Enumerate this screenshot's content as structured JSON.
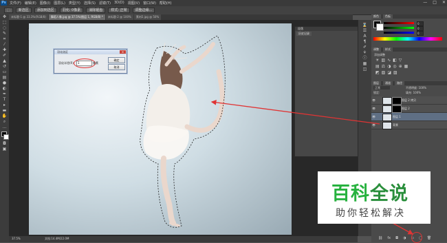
{
  "app": {
    "logo": "Ps"
  },
  "menubar": {
    "items": [
      "文件(F)",
      "编辑(E)",
      "图像(I)",
      "图层(L)",
      "类型(Y)",
      "选择(S)",
      "滤镜(T)",
      "3D(D)",
      "视图(V)",
      "窗口(W)",
      "帮助(H)"
    ],
    "window_controls": [
      "—",
      "□",
      "✕"
    ]
  },
  "options_bar": {
    "items": [
      "新选区",
      "添加到选区",
      "羽化: 0像素",
      "消除锯齿",
      "样式: 正常",
      "调整边缘..."
    ]
  },
  "document_tabs": [
    {
      "label": "未标题-1 @ 33.3%(RGB/8)",
      "active": false
    },
    {
      "label": "舞蹈人像.jpg @ 37.5%(图层 1, RGB/8) *",
      "active": true
    },
    {
      "label": "未标题-2 @ 100%",
      "active": false
    },
    {
      "label": "素材2.jpg @ 50%",
      "active": false
    }
  ],
  "dialog": {
    "title": "羽化选区",
    "field_label": "羽化半径(R):",
    "field_value": "1",
    "unit": "像素",
    "ok_label": "确定",
    "cancel_label": "取消",
    "close_label": "✕"
  },
  "floating_panel": {
    "header": "段落",
    "tab": "历史记录"
  },
  "right_panel": {
    "color_tabs": [
      "颜色",
      "色板"
    ],
    "color_values": [
      "0",
      "0",
      "0"
    ],
    "swatch_tabs": [
      "调整",
      "样式"
    ],
    "adjust_label": "添加调整",
    "layers_tabs": [
      "图层",
      "通道",
      "路径"
    ],
    "mode_label": "正常",
    "opacity_label": "不透明度: 100%",
    "lock_label": "锁定:",
    "fill_label": "填充: 100%",
    "layers": [
      {
        "name": "图层 2 拷贝",
        "selected": false,
        "mask": true
      },
      {
        "name": "图层 2",
        "selected": false,
        "mask": true
      },
      {
        "name": "图层 1",
        "selected": true,
        "mask": false
      },
      {
        "name": "背景",
        "selected": false,
        "mask": false
      }
    ]
  },
  "status": {
    "zoom": "37.5%",
    "doc_info": "文档:14.4M/22.0M"
  },
  "watermark": {
    "line1a": "百科",
    "line1b": "全说",
    "line2": "助你轻松解决"
  },
  "colors": {
    "annotation_red": "#e03434",
    "watermark_green": "#27b23f"
  }
}
